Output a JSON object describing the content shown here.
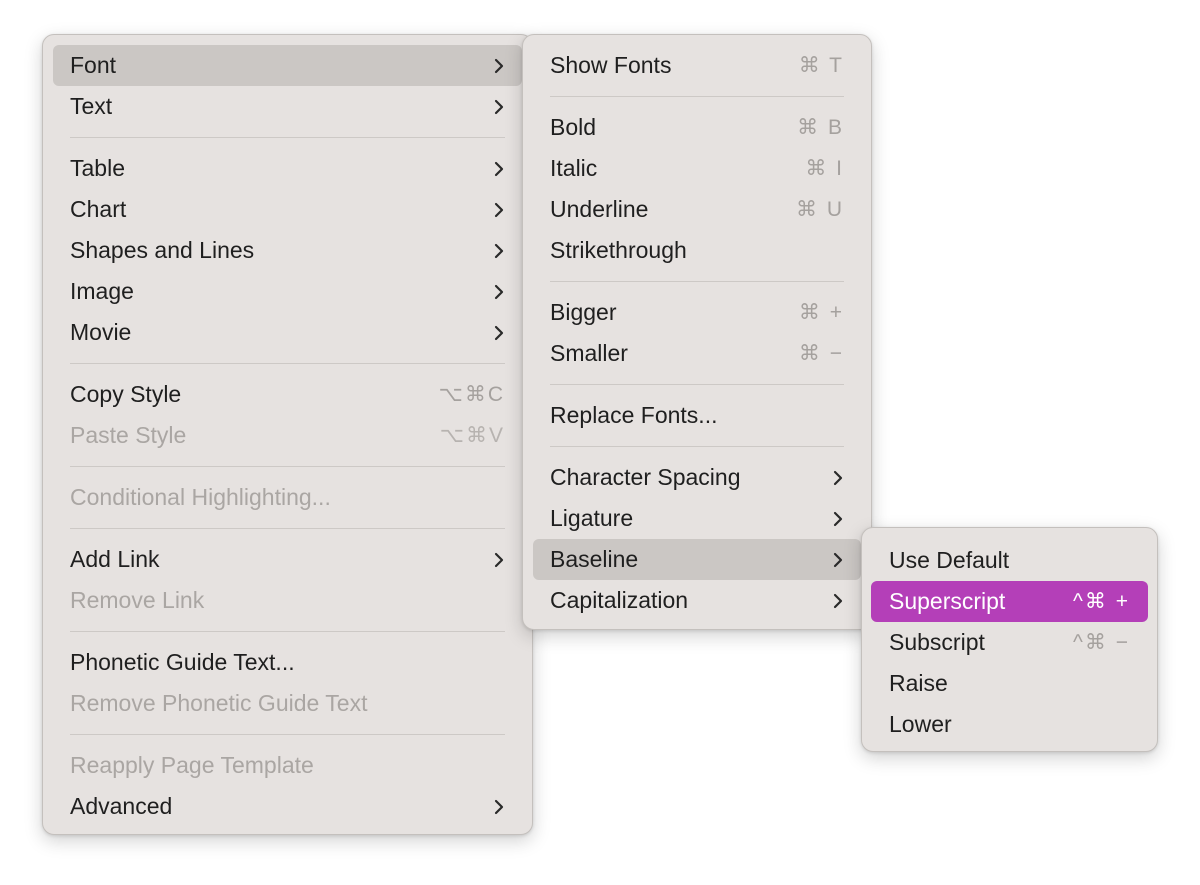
{
  "format_menu": {
    "items": [
      {
        "label": "Font"
      },
      {
        "label": "Text"
      },
      {
        "label": "Table"
      },
      {
        "label": "Chart"
      },
      {
        "label": "Shapes and Lines"
      },
      {
        "label": "Image"
      },
      {
        "label": "Movie"
      },
      {
        "label": "Copy Style",
        "shortcut": "⌥⌘C"
      },
      {
        "label": "Paste Style",
        "shortcut": "⌥⌘V"
      },
      {
        "label": "Conditional Highlighting..."
      },
      {
        "label": "Add Link"
      },
      {
        "label": "Remove Link"
      },
      {
        "label": "Phonetic Guide Text..."
      },
      {
        "label": "Remove Phonetic Guide Text"
      },
      {
        "label": "Reapply Page Template"
      },
      {
        "label": "Advanced"
      }
    ]
  },
  "font_menu": {
    "items": [
      {
        "label": "Show Fonts",
        "shortcut": "⌘ T"
      },
      {
        "label": "Bold",
        "shortcut": "⌘ B"
      },
      {
        "label": "Italic",
        "shortcut": "⌘ I"
      },
      {
        "label": "Underline",
        "shortcut": "⌘ U"
      },
      {
        "label": "Strikethrough"
      },
      {
        "label": "Bigger",
        "shortcut": "⌘ +"
      },
      {
        "label": "Smaller",
        "shortcut": "⌘ −"
      },
      {
        "label": "Replace Fonts..."
      },
      {
        "label": "Character Spacing"
      },
      {
        "label": "Ligature"
      },
      {
        "label": "Baseline"
      },
      {
        "label": "Capitalization"
      }
    ]
  },
  "baseline_menu": {
    "items": [
      {
        "label": "Use Default"
      },
      {
        "label": "Superscript",
        "shortcut": "^⌘ +"
      },
      {
        "label": "Subscript",
        "shortcut": "^⌘ −"
      },
      {
        "label": "Raise"
      },
      {
        "label": "Lower"
      }
    ]
  },
  "icons": {
    "submenu_arrow": "chevron-right-icon"
  },
  "colors": {
    "highlight": "#b43fb8",
    "selected": "#cbc7c4",
    "menu_bg": "#e6e2e0",
    "disabled_text": "#aaa6a3"
  }
}
